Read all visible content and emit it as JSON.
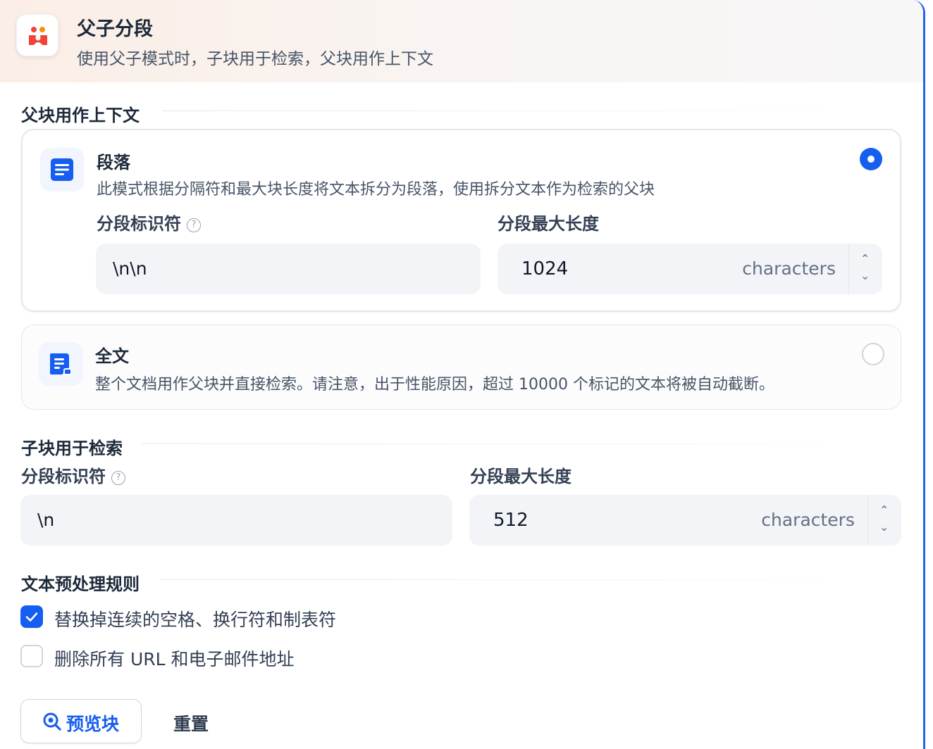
{
  "header": {
    "title": "父子分段",
    "description": "使用父子模式时，子块用于检索，父块用作上下文",
    "icon": "parent-child-icon",
    "icon_color": "#f04438"
  },
  "parent_section": {
    "title": "父块用作上下文",
    "options": [
      {
        "title": "段落",
        "description": "此模式根据分隔符和最大块长度将文本拆分为段落，使用拆分文本作为检索的父块",
        "selected": true,
        "icon": "paragraph-icon",
        "separator_label": "分段标识符",
        "separator_value": "\\n\\n",
        "max_length_label": "分段最大长度",
        "max_length_value": "1024",
        "max_length_unit": "characters"
      },
      {
        "title": "全文",
        "description": "整个文档用作父块并直接检索。请注意，出于性能原因，超过 10000 个标记的文本将被自动截断。",
        "selected": false,
        "icon": "document-icon"
      }
    ]
  },
  "child_section": {
    "title": "子块用于检索",
    "separator_label": "分段标识符",
    "separator_value": "\\n",
    "max_length_label": "分段最大长度",
    "max_length_value": "512",
    "max_length_unit": "characters"
  },
  "preprocess": {
    "title": "文本预处理规则",
    "rules": [
      {
        "label": "替换掉连续的空格、换行符和制表符",
        "checked": true
      },
      {
        "label": "删除所有 URL 和电子邮件地址",
        "checked": false
      }
    ]
  },
  "actions": {
    "preview_label": "预览块",
    "reset_label": "重置"
  },
  "colors": {
    "accent": "#155eef",
    "border_right": "#2563eb"
  }
}
